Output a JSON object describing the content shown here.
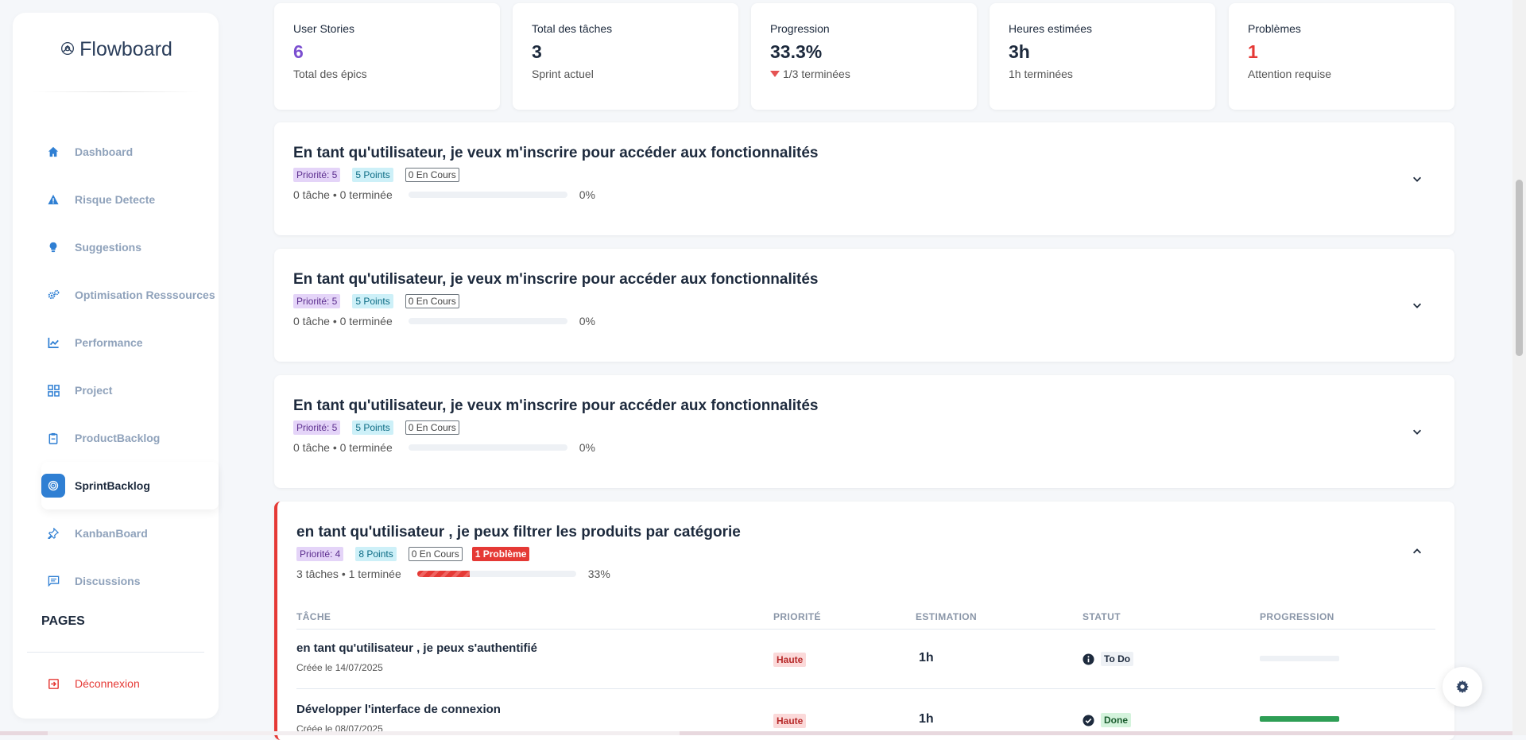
{
  "brand": {
    "name": "Flowboard"
  },
  "sidebar": {
    "items": [
      {
        "label": "Dashboard",
        "icon": "home-icon"
      },
      {
        "label": "Risque Detecte",
        "icon": "warning-icon"
      },
      {
        "label": "Suggestions",
        "icon": "lightbulb-icon"
      },
      {
        "label": "Optimisation Resssources",
        "icon": "gears-icon"
      },
      {
        "label": "Performance",
        "icon": "chart-line-icon"
      },
      {
        "label": "Project",
        "icon": "grid-icon"
      },
      {
        "label": "ProductBacklog",
        "icon": "clipboard-icon"
      },
      {
        "label": "SprintBacklog",
        "icon": "target-icon",
        "active": true
      },
      {
        "label": "KanbanBoard",
        "icon": "pin-icon"
      },
      {
        "label": "Discussions",
        "icon": "chat-icon"
      }
    ],
    "pages_label": "PAGES",
    "logout_label": "Déconnexion"
  },
  "stats": [
    {
      "label": "User Stories",
      "value": "6",
      "sub": "Total des épics",
      "color": "#7b4fd0"
    },
    {
      "label": "Total des tâches",
      "value": "3",
      "sub": "Sprint actuel",
      "color": "#1d2a3d"
    },
    {
      "label": "Progression",
      "value": "33.3%",
      "sub": "1/3 terminées",
      "color": "#1d2a3d"
    },
    {
      "label": "Heures estimées",
      "value": "3h",
      "sub": "1h terminées",
      "color": "#1d2a3d"
    },
    {
      "label": "Problèmes",
      "value": "1",
      "sub": "Attention requise",
      "color": "#e53935"
    }
  ],
  "stories": [
    {
      "title": "En tant qu'utilisateur, je veux m'inscrire pour accéder aux fonctionnalités",
      "priority": "Priorité: 5",
      "points": "5 Points",
      "en_cours": "0 En Cours",
      "summary": "0 tâche • 0 terminée",
      "percent": "0%",
      "progress": 0
    },
    {
      "title": "En tant qu'utilisateur, je veux m'inscrire pour accéder aux fonctionnalités",
      "priority": "Priorité: 5",
      "points": "5 Points",
      "en_cours": "0 En Cours",
      "summary": "0 tâche • 0 terminée",
      "percent": "0%",
      "progress": 0
    },
    {
      "title": "En tant qu'utilisateur, je veux m'inscrire pour accéder aux fonctionnalités",
      "priority": "Priorité: 5",
      "points": "5 Points",
      "en_cours": "0 En Cours",
      "summary": "0 tâche • 0 terminée",
      "percent": "0%",
      "progress": 0
    }
  ],
  "expanded_story": {
    "title": "en tant qu'utilisateur , je peux filtrer les produits par catégorie",
    "priority": "Priorité: 4",
    "points": "8 Points",
    "en_cours": "0 En Cours",
    "problem": "1 Problème",
    "summary": "3 tâches • 1 terminée",
    "percent": "33%",
    "progress": 0.33,
    "columns": [
      "TÂCHE",
      "PRIORITÉ",
      "ESTIMATION",
      "STATUT",
      "PROGRESSION"
    ],
    "tasks": [
      {
        "name": "en tant qu'utilisateur , je peux s'authentifié",
        "date": "Créée le 14/07/2025",
        "priority": "Haute",
        "estimate": "1h",
        "status": "To Do",
        "status_icon": "info-icon",
        "progress": 0
      },
      {
        "name": "Développer l'interface de connexion",
        "date": "Créée le 08/07/2025",
        "priority": "Haute",
        "estimate": "1h",
        "status": "Done",
        "status_icon": "check-circle-icon",
        "progress": 1
      }
    ]
  }
}
